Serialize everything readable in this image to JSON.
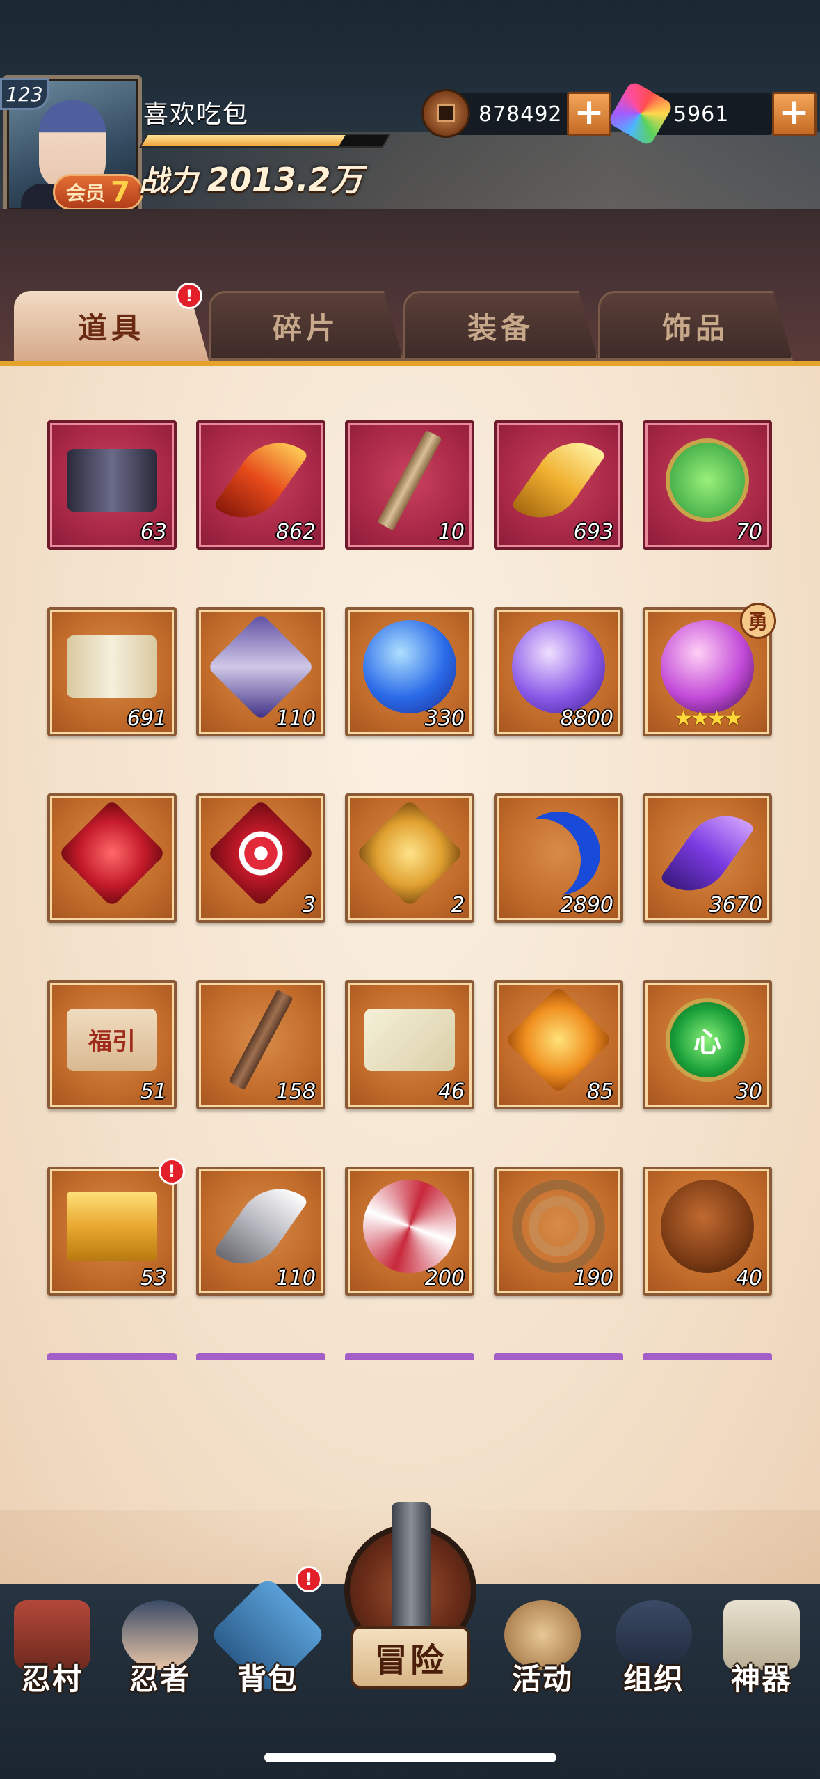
{
  "player": {
    "level": "123",
    "name": "喜欢吃包",
    "vip_label": "会员",
    "vip_level": "7",
    "power_label": "战力",
    "power_value": "2013.2万",
    "exp_progress": 0.82
  },
  "currencies": [
    {
      "icon": "copper-coin-icon",
      "value": "878492",
      "plus": "+"
    },
    {
      "icon": "rainbow-gem-icon",
      "value": "5961",
      "plus": "+"
    }
  ],
  "tabs": [
    {
      "label": "道具",
      "active": true,
      "alert": "!"
    },
    {
      "label": "碎片",
      "active": false
    },
    {
      "label": "装备",
      "active": false
    },
    {
      "label": "饰品",
      "active": false
    }
  ],
  "items": [
    {
      "icon": "scroll-icon",
      "count": "63",
      "bg": "red"
    },
    {
      "icon": "red-feather-icon",
      "count": "862",
      "bg": "red"
    },
    {
      "icon": "wooden-stick-icon",
      "count": "10",
      "bg": "red"
    },
    {
      "icon": "golden-feather-icon",
      "count": "693",
      "bg": "red"
    },
    {
      "icon": "green-charm-icon",
      "count": "70",
      "bg": "red"
    },
    {
      "icon": "map-scroll-icon",
      "count": "691",
      "bg": "orange"
    },
    {
      "icon": "purple-cloth-icon",
      "count": "110",
      "bg": "orange"
    },
    {
      "icon": "blue-orb-icon",
      "count": "330",
      "bg": "orange"
    },
    {
      "icon": "purple-orb-icon",
      "count": "8800",
      "bg": "orange"
    },
    {
      "icon": "pink-orb-icon",
      "count": "",
      "bg": "orange",
      "tag": "勇",
      "stars": "★★★★"
    },
    {
      "icon": "red-stone-icon",
      "count": "",
      "bg": "orange"
    },
    {
      "icon": "red-target-stone-icon",
      "count": "3",
      "bg": "orange"
    },
    {
      "icon": "yellow-lightning-stone-icon",
      "count": "2",
      "bg": "orange"
    },
    {
      "icon": "blue-crescent-icon",
      "count": "2890",
      "bg": "orange"
    },
    {
      "icon": "purple-crystal-icon",
      "count": "3670",
      "bg": "orange"
    },
    {
      "icon": "fortune-banner-icon",
      "count": "51",
      "bg": "orange",
      "text": "福引"
    },
    {
      "icon": "key-icon",
      "count": "158",
      "bg": "orange"
    },
    {
      "icon": "paper-talisman-icon",
      "count": "46",
      "bg": "orange"
    },
    {
      "icon": "amber-gem-icon",
      "count": "85",
      "bg": "orange"
    },
    {
      "icon": "green-heart-gem-icon",
      "count": "30",
      "bg": "orange",
      "text": "心"
    },
    {
      "icon": "gold-chest-icon",
      "count": "53",
      "bg": "orange",
      "alert": "!"
    },
    {
      "icon": "white-kunai-icon",
      "count": "110",
      "bg": "orange"
    },
    {
      "icon": "war-fan-icon",
      "count": "200",
      "bg": "orange"
    },
    {
      "icon": "rope-icon",
      "count": "190",
      "bg": "orange"
    },
    {
      "icon": "gourd-icon",
      "count": "40",
      "bg": "orange"
    }
  ],
  "nav": [
    {
      "label": "忍村",
      "icon": "village-gate-icon"
    },
    {
      "label": "忍者",
      "icon": "ninja-head-icon"
    },
    {
      "label": "背包",
      "icon": "backpack-icon",
      "alert": "!"
    },
    {
      "label": "冒险",
      "icon": "adventure-scroll-icon"
    },
    {
      "label": "活动",
      "icon": "drum-kunai-icon"
    },
    {
      "label": "组织",
      "icon": "masked-ninja-icon"
    },
    {
      "label": "神器",
      "icon": "artifact-scroll-icon"
    }
  ],
  "colors": {
    "slot_red": "#a92847",
    "slot_orange": "#c26b2a",
    "tab_underline": "#e5a32a",
    "alert_red": "#e3202a"
  }
}
